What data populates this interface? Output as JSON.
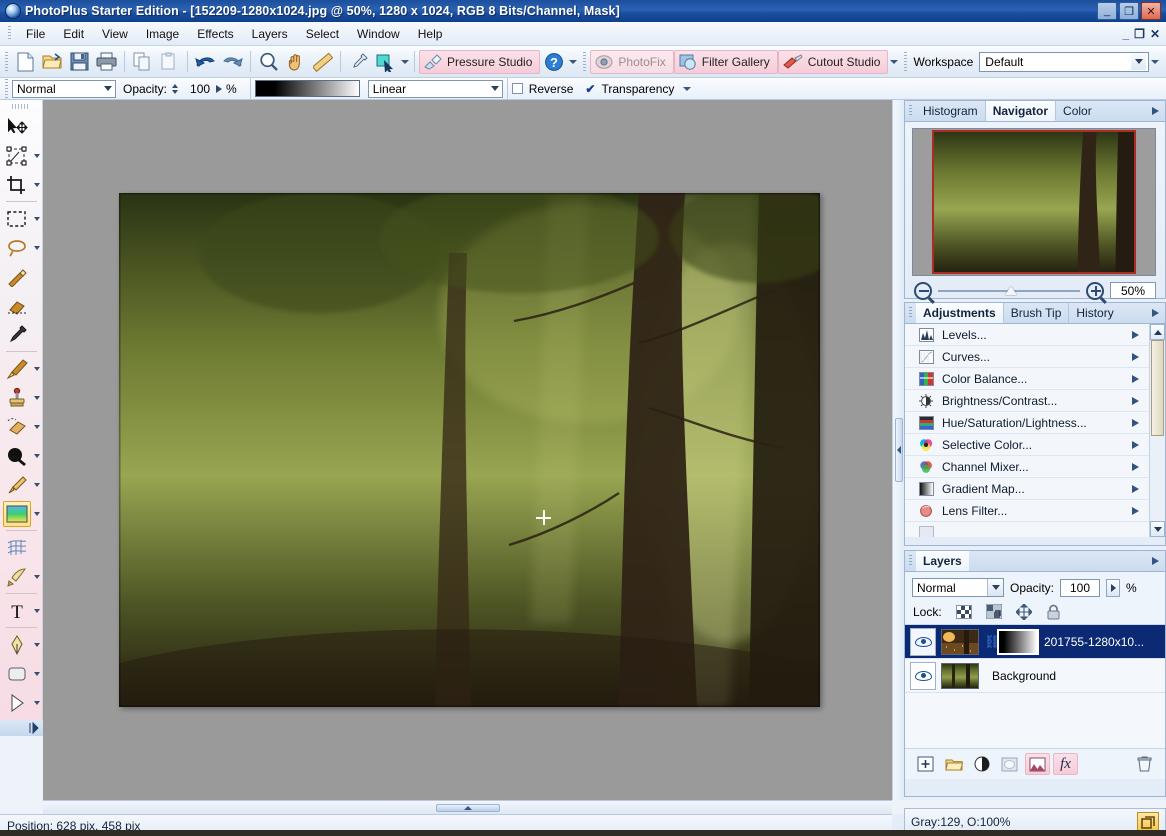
{
  "window": {
    "title": "PhotoPlus Starter Edition - [152209-1280x1024.jpg @ 50%, 1280 x 1024, RGB 8 Bits/Channel, Mask]",
    "minimize": "_",
    "maximize": "❐",
    "close": "✕",
    "doc_minimize": "_",
    "doc_restore": "❐",
    "doc_close": "✕"
  },
  "menu": {
    "items": [
      "File",
      "Edit",
      "View",
      "Image",
      "Layers",
      "Select",
      "Window",
      "Help"
    ]
  },
  "toolbar": {
    "buttons": [
      {
        "name": "new-icon",
        "title": "New"
      },
      {
        "name": "open-folder-icon",
        "title": "Open"
      },
      {
        "name": "save-floppy-icon",
        "title": "Save"
      },
      {
        "name": "print-icon",
        "title": "Print"
      },
      {
        "name": "copy-icon",
        "title": "Copy"
      },
      {
        "name": "paste-icon",
        "title": "Paste"
      },
      {
        "name": "undo-arrow-icon",
        "title": "Undo"
      },
      {
        "name": "redo-arrow-icon",
        "title": "Redo"
      },
      {
        "name": "zoom-magnifier-icon",
        "title": "Zoom"
      },
      {
        "name": "pan-hand-icon",
        "title": "Pan"
      },
      {
        "name": "measure-ruler-icon",
        "title": "Measure"
      },
      {
        "name": "eyedropper-icon",
        "title": "Colour Pickup"
      },
      {
        "name": "node-select-icon",
        "title": "Node Edit"
      }
    ],
    "pressure_studio": "Pressure Studio",
    "help_label": "?",
    "photofix": "PhotoFix",
    "filter_gallery": "Filter Gallery",
    "cutout_studio": "Cutout Studio",
    "workspace_label": "Workspace",
    "workspace_value": "Default"
  },
  "options": {
    "blend_mode": "Normal",
    "opacity_label": "Opacity:",
    "opacity_value": "100",
    "percent": "%",
    "gradient_type": "Linear",
    "reverse_label": "Reverse",
    "reverse_checked": false,
    "transparency_label": "Transparency",
    "transparency_checked": true
  },
  "tools": [
    {
      "name": "move-tool",
      "label": "Move",
      "has_flyout": false
    },
    {
      "name": "deform-tool",
      "label": "Deform",
      "has_flyout": true
    },
    {
      "name": "crop-tool",
      "label": "Crop",
      "has_flyout": true
    },
    {
      "name": "rectangle-select-tool",
      "label": "Rectangle Select",
      "has_flyout": true
    },
    {
      "name": "lasso-select-tool",
      "label": "Freehand Select",
      "has_flyout": true
    },
    {
      "name": "magic-wand-tool",
      "label": "Magic Wand",
      "has_flyout": false
    },
    {
      "name": "background-eraser-tool",
      "label": "Background Eraser",
      "has_flyout": false
    },
    {
      "name": "color-pickup-tool",
      "label": "Colour Pickup",
      "has_flyout": false
    },
    {
      "name": "paintbrush-tool",
      "label": "Paintbrush",
      "has_flyout": true
    },
    {
      "name": "clone-tool",
      "label": "Clone",
      "has_flyout": true
    },
    {
      "name": "eraser-tool",
      "label": "Eraser",
      "has_flyout": true
    },
    {
      "name": "flood-fill-tool",
      "label": "Flood Fill",
      "has_flyout": true
    },
    {
      "name": "smudge-tool",
      "label": "Smudge",
      "has_flyout": true
    },
    {
      "name": "gradient-fill-tool",
      "label": "Gradient Fill",
      "has_flyout": true,
      "selected": true
    },
    {
      "name": "mesh-warp-tool",
      "label": "Mesh Warp",
      "has_flyout": false
    },
    {
      "name": "warp-brush-tool",
      "label": "Warp Brush",
      "has_flyout": true
    },
    {
      "name": "text-tool",
      "label": "Text",
      "has_flyout": true
    },
    {
      "name": "pen-tool",
      "label": "Pen",
      "has_flyout": true
    },
    {
      "name": "shape-tool",
      "label": "Shape",
      "has_flyout": true
    },
    {
      "name": "node-edit-tool",
      "label": "Node Edit",
      "has_flyout": true
    }
  ],
  "navigator": {
    "tabs": [
      {
        "label": "Histogram",
        "active": false
      },
      {
        "label": "Navigator",
        "active": true
      },
      {
        "label": "Color",
        "active": false
      }
    ],
    "zoom_out_icon": "zoom-out-icon",
    "zoom_in_icon": "zoom-in-icon",
    "zoom_value": "50%"
  },
  "adjustments": {
    "tabs": [
      {
        "label": "Adjustments",
        "active": true
      },
      {
        "label": "Brush Tip",
        "active": false
      },
      {
        "label": "History",
        "active": false
      }
    ],
    "items": [
      {
        "label": "Levels...",
        "icon": "levels-histogram-icon"
      },
      {
        "label": "Curves...",
        "icon": "curves-icon"
      },
      {
        "label": "Color Balance...",
        "icon": "color-balance-icon"
      },
      {
        "label": "Brightness/Contrast...",
        "icon": "brightness-contrast-icon"
      },
      {
        "label": "Hue/Saturation/Lightness...",
        "icon": "hue-saturation-icon"
      },
      {
        "label": "Selective Color...",
        "icon": "selective-color-icon"
      },
      {
        "label": "Channel Mixer...",
        "icon": "channel-mixer-icon"
      },
      {
        "label": "Gradient Map...",
        "icon": "gradient-map-icon"
      },
      {
        "label": "Lens Filter...",
        "icon": "lens-filter-icon"
      }
    ]
  },
  "layers": {
    "tab_label": "Layers",
    "blend_mode": "Normal",
    "opacity_label": "Opacity:",
    "opacity_value": "100",
    "percent": "%",
    "lock_label": "Lock:",
    "lock_buttons": [
      {
        "name": "lock-transparency-icon"
      },
      {
        "name": "lock-image-icon"
      },
      {
        "name": "lock-position-icon"
      },
      {
        "name": "lock-all-icon"
      }
    ],
    "rows": [
      {
        "name": "201755-1280x10...",
        "selected": true,
        "visible": true,
        "has_mask": true,
        "linked": true
      },
      {
        "name": "Background",
        "selected": false,
        "visible": true,
        "has_mask": false,
        "linked": false
      }
    ],
    "footer_buttons": [
      {
        "name": "add-layer-icon",
        "glyph": "+"
      },
      {
        "name": "new-group-folder-icon",
        "glyph": ""
      },
      {
        "name": "adjustment-layer-icon",
        "glyph": ""
      },
      {
        "name": "mask-layer-icon",
        "glyph": ""
      },
      {
        "name": "layer-mask-icon",
        "glyph": "",
        "highlighted": true
      },
      {
        "name": "layer-effects-fx-icon",
        "glyph": "fx",
        "highlighted": true
      },
      {
        "name": "delete-layer-trash-icon",
        "glyph": ""
      }
    ]
  },
  "status": {
    "position": "Position: 628 pix, 458 pix",
    "right": "Gray:129, O:100%",
    "right_icon": "new-window-icon"
  }
}
